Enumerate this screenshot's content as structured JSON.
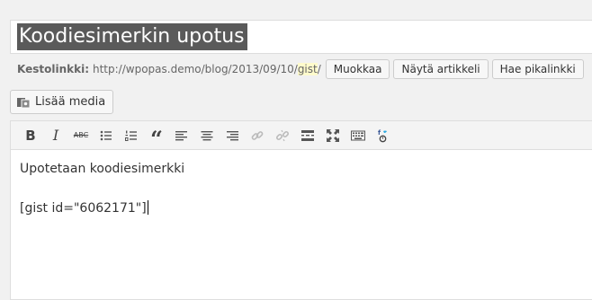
{
  "post_title": "Koodiesimerkin upotus",
  "permalink": {
    "label": "Kestolinkki:",
    "base": "http://wpopas.demo/blog/2013/09/10/",
    "slug": "gist",
    "tail": "/",
    "buttons": [
      "Muokkaa",
      "Näytä artikkeli",
      "Hae pikalinkki"
    ]
  },
  "add_media_label": "Lisää media",
  "toolbar": {
    "icons": [
      "bold-icon",
      "italic-icon",
      "strikethrough-icon",
      "bullet-list-icon",
      "numbered-list-icon",
      "blockquote-icon",
      "align-left-icon",
      "align-center-icon",
      "align-right-icon",
      "insert-link-icon",
      "remove-link-icon",
      "read-more-icon",
      "fullscreen-icon",
      "toolbar-toggle-icon",
      "social-share-icon"
    ],
    "bold_label": "B",
    "italic_label": "I",
    "strike_label": "ABC",
    "quote_label": "“"
  },
  "content": {
    "line1": "Upotetaan koodiesimerkki",
    "line2": "[gist id=\"6062171\"]"
  }
}
